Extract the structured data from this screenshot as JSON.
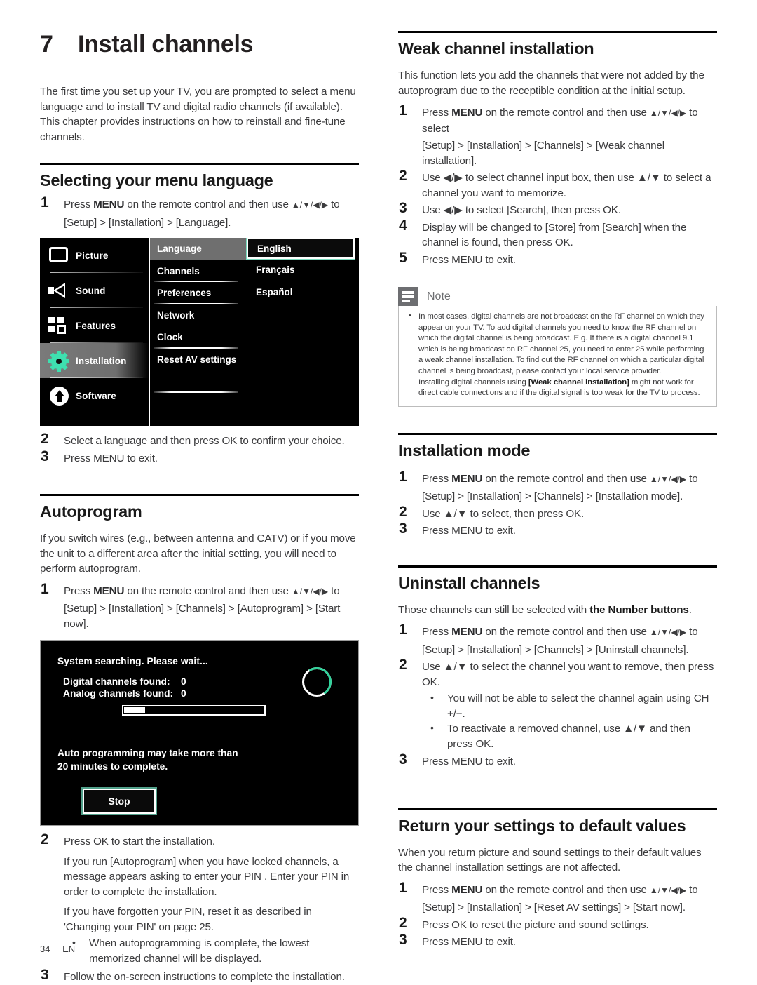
{
  "chapter": {
    "number": "7",
    "title": "Install channels",
    "intro": "The first time you set up your TV, you are prompted to select a menu language and to install TV and digital radio channels (if available). This chapter provides instructions on how to reinstall and fine-tune channels."
  },
  "sections": {
    "menu_language": {
      "heading": "Selecting your menu language",
      "step1_a": "Press ",
      "step1_menu": "MENU",
      "step1_b": " on the remote control and then use ",
      "step1_arrows": "▲/▼/◀/▶",
      "step1_c": " to select [Setup] > [Installation] > [Language].",
      "step1_path": "[Setup] > [Installation] > [Language].",
      "step2": "Select a language and then press OK to confirm your choice.",
      "step3": "Press MENU to exit."
    },
    "autoprogram": {
      "heading": "Autoprogram",
      "intro": "If you switch wires (e.g., between antenna and CATV) or if you move the unit to a different area after the initial setting, you will need to perform autoprogram.",
      "step1_path": "[Setup] > [Installation] > [Channels] > [Autoprogram] > [Start now].",
      "step2": "Press OK to start the installation.",
      "step2_p1": "If you run [Autoprogram] when you have locked channels, a message appears asking to enter your PIN . Enter your PIN in order to complete the installation.",
      "step2_p2": "If you have forgotten your PIN, reset it as described in 'Changing your PIN' on page 25.",
      "step2_bullet": "When autoprogramming is complete, the lowest memorized channel will be displayed.",
      "step3": "Follow the on-screen instructions to complete the installation."
    },
    "weak_channel": {
      "heading": "Weak channel installation",
      "intro": "This function lets you add the channels that were not added by the autoprogram due to the receptible condition at the initial setup.",
      "step1_path": "[Setup] > [Installation] > [Channels] > [Weak channel installation].",
      "step2": "Use ◀/▶ to select channel input box, then use ▲/▼ to select a channel you want to memorize.",
      "step3": "Use ◀/▶ to select [Search], then press OK.",
      "step4": "Display will be changed to [Store] from [Search] when the channel is found, then press OK.",
      "step5": "Press MENU to exit."
    },
    "installation_mode": {
      "heading": "Installation mode",
      "step1_path": "[Setup] > [Installation] > [Channels] > [Installation mode].",
      "step2": "Use ▲/▼ to select, then press OK.",
      "step3": "Press MENU to exit."
    },
    "uninstall": {
      "heading": "Uninstall channels",
      "intro": "Those channels can still be selected with the Number buttons.",
      "step1_path": "[Setup] > [Installation] > [Channels] > [Uninstall channels].",
      "step2": "Use ▲/▼ to select the channel you want to remove, then press OK.",
      "bullet1": "You will not be able to select the channel again using CH +/−.",
      "bullet2": "To reactivate a removed channel, use ▲/▼ and then press OK.",
      "step3": "Press MENU to exit."
    },
    "reset_defaults": {
      "heading": "Return your settings to default values",
      "intro": "When you return picture and sound settings to their default values the channel installation settings are not affected.",
      "step1_path": "[Setup] > [Installation] > [Reset AV settings] > [Start now].",
      "step2": "Press OK to reset the picture and sound settings.",
      "step3": "Press MENU to exit."
    }
  },
  "osd_language_menu": {
    "sidebar": [
      {
        "label": "Picture",
        "icon": "picture-icon",
        "active": false
      },
      {
        "label": "Sound",
        "icon": "speaker-icon",
        "active": false
      },
      {
        "label": "Features",
        "icon": "blocks-icon",
        "active": false
      },
      {
        "label": "Installation",
        "icon": "gear-icon",
        "active": true
      },
      {
        "label": "Software",
        "icon": "upload-circle-icon",
        "active": false
      }
    ],
    "middle": [
      "Language",
      "Channels",
      "Preferences",
      "Network",
      "Clock",
      "Reset AV settings"
    ],
    "middle_selected": "Language",
    "options": [
      "English",
      "Français",
      "Español"
    ],
    "option_selected": "English",
    "accent_color": "#3ee0b0",
    "highlight_color": "#6f6f6f"
  },
  "osd_autoprogram": {
    "title": "System searching. Please wait...",
    "digital_label": "Digital channels found:",
    "digital_value": "0",
    "analog_label": "Analog channels found:",
    "analog_value": "0",
    "progress_percent": 15,
    "message_line1": "Auto programming may take more than",
    "message_line2": "20 minutes to complete.",
    "stop_button": "Stop",
    "spinner_color": "#2fd39b"
  },
  "note": {
    "title": "Note",
    "icon": "note-lines-icon",
    "bullets": [
      {
        "part1": "In most cases, digital channels are not broadcast on the RF channel on which they appear on your TV. To add digital channels you need to know the RF channel on which the digital channel is being broadcast. E.g. If there is a digital channel 9.1 which is being broadcast on RF channel 25, you need to enter 25 while performing a weak channel installation. To find out the RF channel on which a particular digital channel is being broadcast, please contact your local service provider.",
        "part2_pre": "Installing digital channels using ",
        "part2_bold": "[Weak channel installation]",
        "part2_post": " might not work for direct cable connections and if the digital signal is too weak for the TV to process."
      }
    ]
  },
  "footer": {
    "page_number": "34",
    "language_code": "EN"
  }
}
